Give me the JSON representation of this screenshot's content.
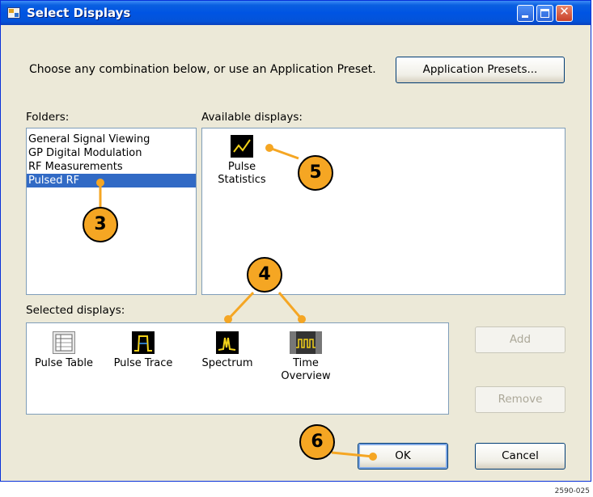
{
  "window": {
    "title": "Select Displays"
  },
  "intro": {
    "text": "Choose any combination below, or use an Application Preset."
  },
  "buttons": {
    "application_presets": "Application Presets...",
    "add": "Add",
    "remove": "Remove",
    "ok": "OK",
    "cancel": "Cancel"
  },
  "folders": {
    "label": "Folders:",
    "items": [
      {
        "label": "General Signal Viewing",
        "selected": false
      },
      {
        "label": "GP Digital Modulation",
        "selected": false
      },
      {
        "label": "RF Measurements",
        "selected": false
      },
      {
        "label": "Pulsed RF",
        "selected": true
      }
    ]
  },
  "available": {
    "label": "Available displays:",
    "items": [
      {
        "line1": "Pulse",
        "line2": "Statistics",
        "icon": "pulse-statistics-icon"
      }
    ]
  },
  "selected": {
    "label": "Selected displays:",
    "items": [
      {
        "line1": "Pulse Table",
        "line2": "",
        "icon": "pulse-table-icon"
      },
      {
        "line1": "Pulse Trace",
        "line2": "",
        "icon": "pulse-trace-icon"
      },
      {
        "line1": "Spectrum",
        "line2": "",
        "icon": "spectrum-icon"
      },
      {
        "line1": "Time",
        "line2": "Overview",
        "icon": "time-overview-icon"
      }
    ]
  },
  "callouts": {
    "c3": "3",
    "c4": "4",
    "c5": "5",
    "c6": "6"
  },
  "footnote": "2590-025",
  "colors": {
    "callout": "#f5a623",
    "selection": "#316ac5",
    "titlebar": "#0054e3"
  }
}
